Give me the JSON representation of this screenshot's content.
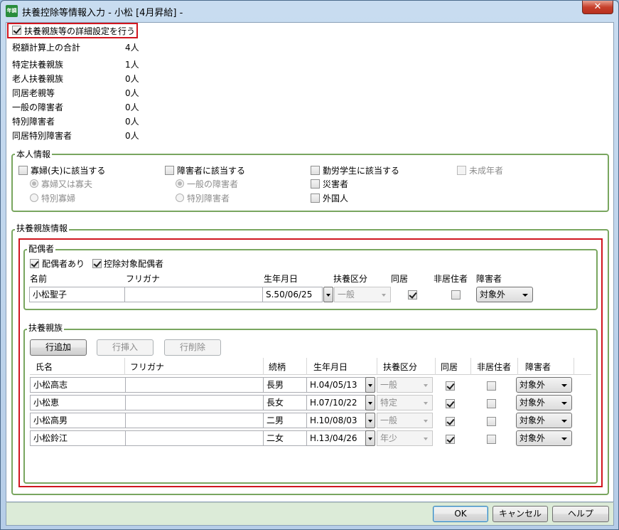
{
  "window": {
    "title": "扶養控除等情報入力 - 小松 [4月昇給] -",
    "close_glyph": "✕",
    "app_icon_text": "年調"
  },
  "detail_setting": {
    "label": "扶養親族等の詳細設定を行う",
    "checked": true
  },
  "summary": [
    {
      "label": "税額計算上の合計",
      "value": "4人"
    },
    {
      "label": "特定扶養親族",
      "value": "1人"
    },
    {
      "label": "老人扶養親族",
      "value": "0人"
    },
    {
      "label": "同居老親等",
      "value": "0人"
    },
    {
      "label": "一般の障害者",
      "value": "0人"
    },
    {
      "label": "特別障害者",
      "value": "0人"
    },
    {
      "label": "同居特別障害者",
      "value": "0人"
    }
  ],
  "self_info": {
    "title": "本人情報",
    "widow": {
      "label": "寡婦(夫)に該当する",
      "opt1": "寡婦又は寡夫",
      "opt2": "特別寡婦"
    },
    "disabled": {
      "label": "障害者に該当する",
      "opt1": "一般の障害者",
      "opt2": "特別障害者"
    },
    "working_student": {
      "label": "勤労学生に該当する"
    },
    "disaster": {
      "label": "災害者"
    },
    "foreigner": {
      "label": "外国人"
    },
    "minor": {
      "label": "未成年者"
    }
  },
  "dependents_info": {
    "title": "扶養親族情報"
  },
  "spouse": {
    "title": "配偶者",
    "has_spouse": "配偶者あり",
    "deduction_target": "控除対象配偶者",
    "headers": {
      "name": "名前",
      "furigana": "フリガナ",
      "birth": "生年月日",
      "category": "扶養区分",
      "cohabit": "同居",
      "nonresident": "非居住者",
      "disability": "障害者"
    },
    "row": {
      "name": "小松聖子",
      "furigana": "",
      "birth": "S.50/06/25",
      "category": "一般",
      "cohabit": true,
      "nonresident": false,
      "disability": "対象外"
    }
  },
  "family": {
    "title": "扶養親族",
    "buttons": {
      "add": "行追加",
      "insert": "行挿入",
      "delete": "行削除"
    },
    "headers": {
      "name": "氏名",
      "furigana": "フリガナ",
      "relation": "続柄",
      "birth": "生年月日",
      "category": "扶養区分",
      "cohabit": "同居",
      "nonresident": "非居住者",
      "disability": "障害者"
    },
    "rows": [
      {
        "name": "小松高志",
        "furigana": "",
        "relation": "長男",
        "birth": "H.04/05/13",
        "category": "一般",
        "cohabit": true,
        "nonresident": false,
        "disability": "対象外"
      },
      {
        "name": "小松恵",
        "furigana": "",
        "relation": "長女",
        "birth": "H.07/10/22",
        "category": "特定",
        "cohabit": true,
        "nonresident": false,
        "disability": "対象外"
      },
      {
        "name": "小松高男",
        "furigana": "",
        "relation": "二男",
        "birth": "H.10/08/03",
        "category": "一般",
        "cohabit": true,
        "nonresident": false,
        "disability": "対象外"
      },
      {
        "name": "小松鈴江",
        "furigana": "",
        "relation": "二女",
        "birth": "H.13/04/26",
        "category": "年少",
        "cohabit": true,
        "nonresident": false,
        "disability": "対象外"
      }
    ]
  },
  "footer": {
    "ok": "OK",
    "cancel": "キャンセル",
    "help": "ヘルプ"
  }
}
